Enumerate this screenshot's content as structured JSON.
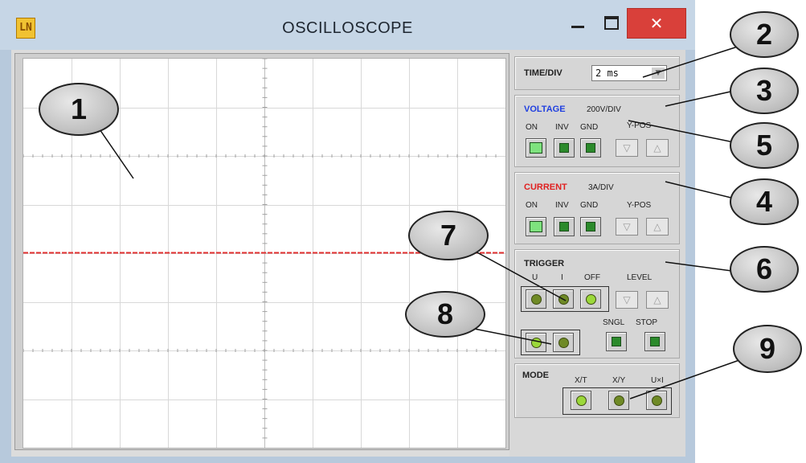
{
  "window": {
    "title": "OSCILLOSCOPE",
    "app_icon": "LN",
    "close_label": "✕"
  },
  "timediv": {
    "label": "TIME/DIV",
    "value": "2 ms"
  },
  "voltage": {
    "title": "VOLTAGE",
    "title_color": "#1f3fe0",
    "scale": "200V/DIV",
    "on": "ON",
    "inv": "INV",
    "gnd": "GND",
    "ypos": "Y-POS"
  },
  "current": {
    "title": "CURRENT",
    "title_color": "#e02020",
    "scale": "3A/DIV",
    "on": "ON",
    "inv": "INV",
    "gnd": "GND",
    "ypos": "Y-POS"
  },
  "trigger": {
    "title": "TRIGGER",
    "u": "U",
    "i": "I",
    "off": "OFF",
    "level": "LEVEL",
    "sngl": "SNGL",
    "stop": "STOP"
  },
  "mode": {
    "title": "MODE",
    "xt": "X/T",
    "xy": "X/Y",
    "uxi": "U×I"
  },
  "trace": {
    "color": "#e03030",
    "level_fraction": 0.5
  },
  "callouts": [
    "1",
    "2",
    "3",
    "4",
    "5",
    "6",
    "7",
    "8",
    "9"
  ]
}
